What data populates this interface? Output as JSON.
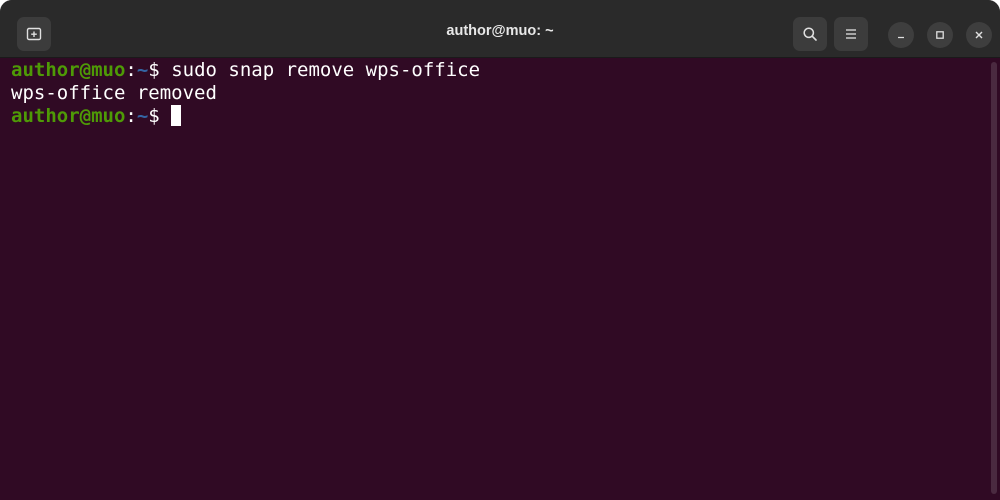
{
  "window": {
    "title": "author@muo: ~"
  },
  "toolbar": {
    "new_tab_icon": "new-tab-icon",
    "search_icon": "search-icon",
    "menu_icon": "hamburger-menu-icon",
    "minimize_icon": "minimize-icon",
    "maximize_icon": "maximize-icon",
    "close_icon": "close-icon"
  },
  "terminal": {
    "lines": [
      {
        "user": "author@muo",
        "colon": ":",
        "path": "~",
        "symbol": "$ ",
        "command": "sudo snap remove wps-office"
      },
      {
        "output": "wps-office removed"
      },
      {
        "user": "author@muo",
        "colon": ":",
        "path": "~",
        "symbol": "$ ",
        "command": ""
      }
    ]
  },
  "colors": {
    "terminal_bg": "#300a24",
    "user_prompt": "#4e9a06",
    "path_prompt": "#3465a4",
    "titlebar_bg": "#2a2a2a",
    "text": "#ffffff"
  }
}
